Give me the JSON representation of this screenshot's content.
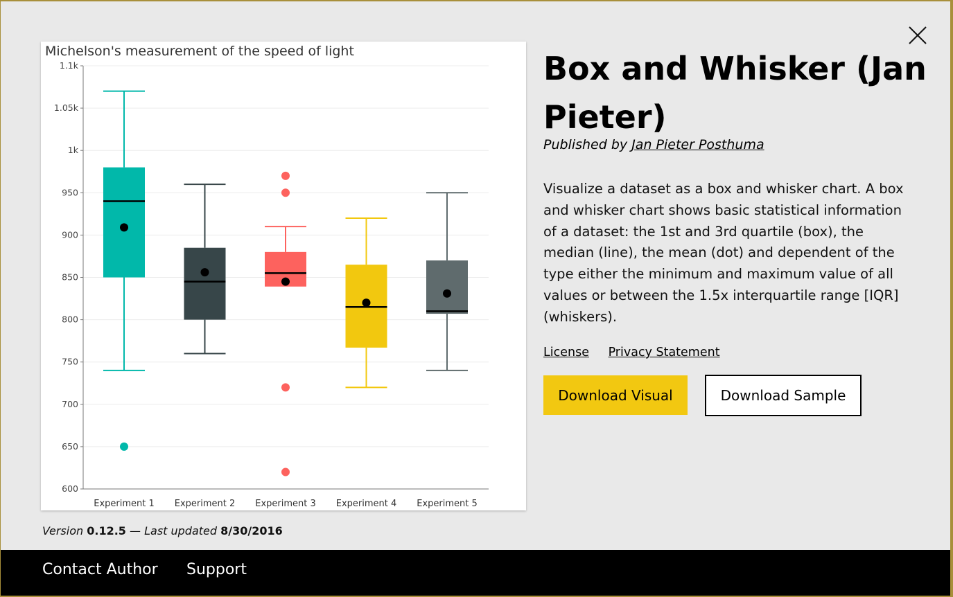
{
  "dialog": {
    "title": "Box and Whisker (Jan Pieter)",
    "published_prefix": "Published by ",
    "publisher": "Jan Pieter Posthuma",
    "description": "Visualize a dataset as a box and whisker chart. A box and whisker chart shows basic statistical information of a dataset: the 1st and 3rd quartile (box), the median (line), the mean (dot) and dependent of the type either the minimum and maximum value of all values or between the 1.5x interquartile range [IQR] (whiskers).",
    "links": {
      "license": "License",
      "privacy": "Privacy Statement"
    },
    "buttons": {
      "download_visual": "Download Visual",
      "download_sample": "Download Sample"
    },
    "version": {
      "version_label": "Version ",
      "version_value": "0.12.5",
      "separator": " — ",
      "updated_label": "Last updated ",
      "updated_value": "8/30/2016"
    },
    "close_icon": "close-icon"
  },
  "footer": {
    "contact": "Contact Author",
    "support": "Support"
  },
  "colors": {
    "accent": "#f2c811",
    "footer_bg": "#000000",
    "dialog_bg": "#e9e9e9"
  },
  "chart_data": {
    "type": "box",
    "title": "Michelson's measurement of the speed of light",
    "xlabel": "",
    "ylabel": "",
    "ylim": [
      600,
      1100
    ],
    "yticks": [
      {
        "value": 600,
        "label": "600"
      },
      {
        "value": 650,
        "label": "650"
      },
      {
        "value": 700,
        "label": "700"
      },
      {
        "value": 750,
        "label": "750"
      },
      {
        "value": 800,
        "label": "800"
      },
      {
        "value": 850,
        "label": "850"
      },
      {
        "value": 900,
        "label": "900"
      },
      {
        "value": 950,
        "label": "950"
      },
      {
        "value": 1000,
        "label": "1k"
      },
      {
        "value": 1050,
        "label": "1.05k"
      },
      {
        "value": 1100,
        "label": "1.1k"
      }
    ],
    "grid": true,
    "categories": [
      "Experiment 1",
      "Experiment 2",
      "Experiment 3",
      "Experiment 4",
      "Experiment 5"
    ],
    "series": [
      {
        "category": "Experiment 1",
        "color": "#01b8aa",
        "min": 740,
        "q1": 850,
        "median": 940,
        "q3": 980,
        "max": 1070,
        "mean": 909,
        "outliers": [
          650
        ]
      },
      {
        "category": "Experiment 2",
        "color": "#374649",
        "min": 760,
        "q1": 800,
        "median": 845,
        "q3": 885,
        "max": 960,
        "mean": 856,
        "outliers": []
      },
      {
        "category": "Experiment 3",
        "color": "#fd625e",
        "min": 840,
        "q1": 840,
        "median": 855,
        "q3": 880,
        "max": 910,
        "mean": 845,
        "outliers": [
          970,
          950,
          720,
          620
        ]
      },
      {
        "category": "Experiment 4",
        "color": "#f2c80f",
        "min": 720,
        "q1": 767,
        "median": 815,
        "q3": 865,
        "max": 920,
        "mean": 820,
        "outliers": []
      },
      {
        "category": "Experiment 5",
        "color": "#5f6b6d",
        "min": 740,
        "q1": 807,
        "median": 810,
        "q3": 870,
        "max": 950,
        "mean": 831,
        "outliers": []
      }
    ]
  }
}
